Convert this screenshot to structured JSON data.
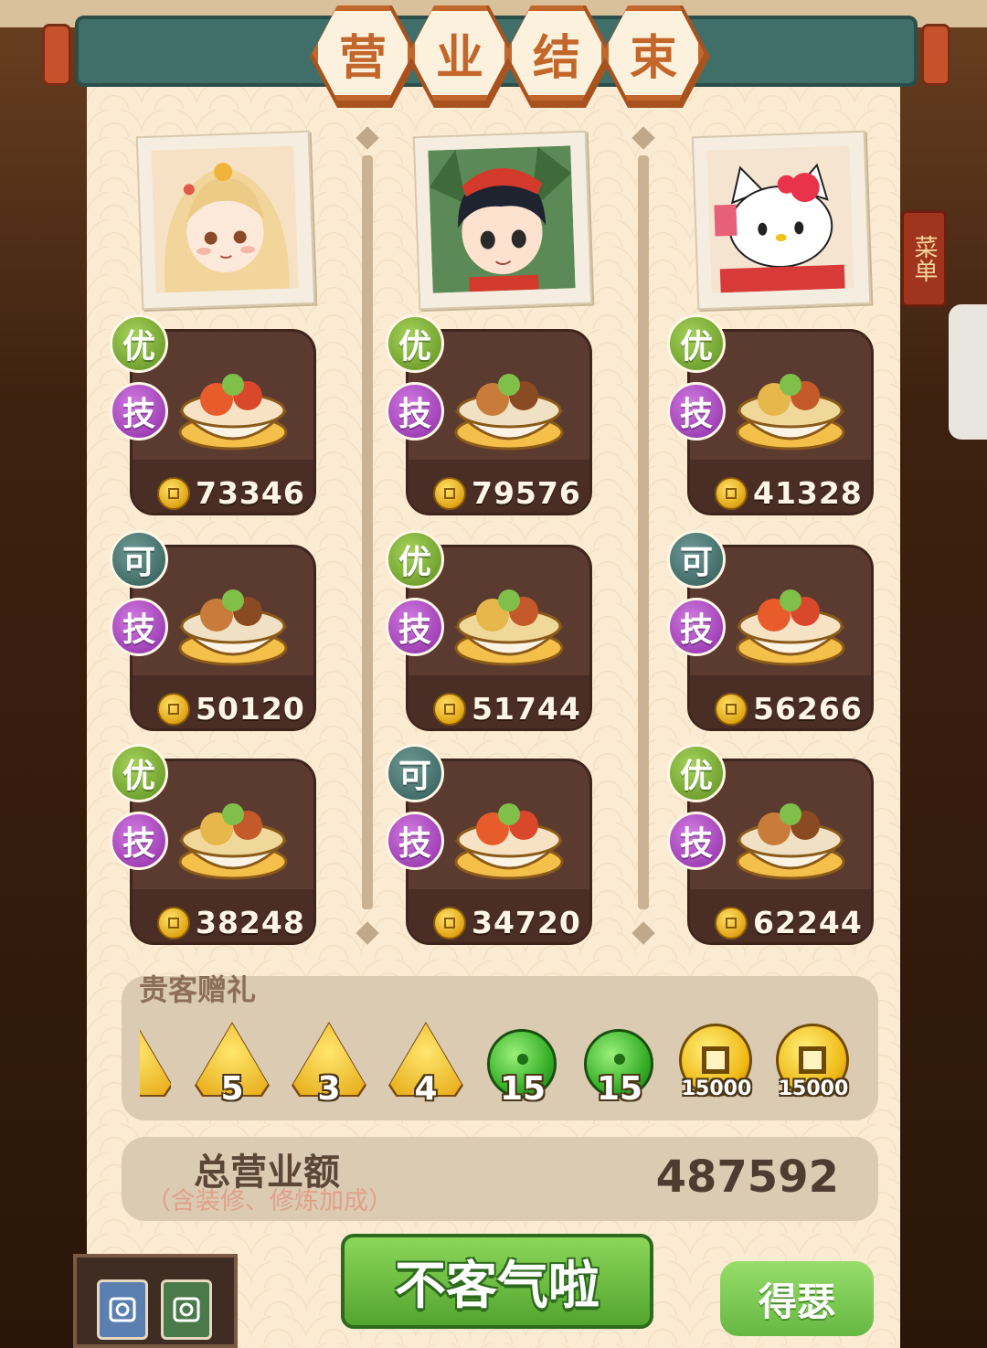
{
  "title": {
    "chars": [
      "营",
      "业",
      "结",
      "束"
    ]
  },
  "menu_sign": "菜单",
  "columns": [
    {
      "portrait": "girl-blonde-avatar",
      "dishes": [
        {
          "rank": "优",
          "skill": "技",
          "score": "73346",
          "icon": "lobster-dish"
        },
        {
          "rank": "可",
          "skill": "技",
          "score": "50120",
          "icon": "fish-dish"
        },
        {
          "rank": "优",
          "skill": "技",
          "score": "38248",
          "icon": "seafood-platter"
        }
      ]
    },
    {
      "portrait": "boy-red-cap-avatar",
      "dishes": [
        {
          "rank": "优",
          "skill": "技",
          "score": "79576",
          "icon": "noodle-pot"
        },
        {
          "rank": "优",
          "skill": "技",
          "score": "51744",
          "icon": "soup-bowl"
        },
        {
          "rank": "可",
          "skill": "技",
          "score": "34720",
          "icon": "clay-pot"
        }
      ]
    },
    {
      "portrait": "hello-kitty-avatar",
      "dishes": [
        {
          "rank": "优",
          "skill": "技",
          "score": "41328",
          "icon": "hotpot"
        },
        {
          "rank": "可",
          "skill": "技",
          "score": "56266",
          "icon": "fish-basket"
        },
        {
          "rank": "优",
          "skill": "技",
          "score": "62244",
          "icon": "crab-grill"
        }
      ]
    }
  ],
  "gifts": {
    "title": "贵客赠礼",
    "items": [
      {
        "type": "zongzi",
        "count": "5"
      },
      {
        "type": "zongzi",
        "count": "3"
      },
      {
        "type": "zongzi",
        "count": "4"
      },
      {
        "type": "jade",
        "count": "15"
      },
      {
        "type": "jade",
        "count": "15"
      },
      {
        "type": "coin",
        "count": "15000"
      },
      {
        "type": "coin",
        "count": "15000"
      }
    ]
  },
  "total": {
    "label": "总营业额",
    "note": "（含装修、修炼加成）",
    "value": "487592"
  },
  "buttons": {
    "confirm": "不客气啦",
    "side": "得瑟"
  },
  "colors": {
    "banner": "#3f6f68",
    "title_border": "#c2662b",
    "paper": "#fbebd3",
    "card": "#5b3a30",
    "confirm_green": "#53a52f"
  }
}
